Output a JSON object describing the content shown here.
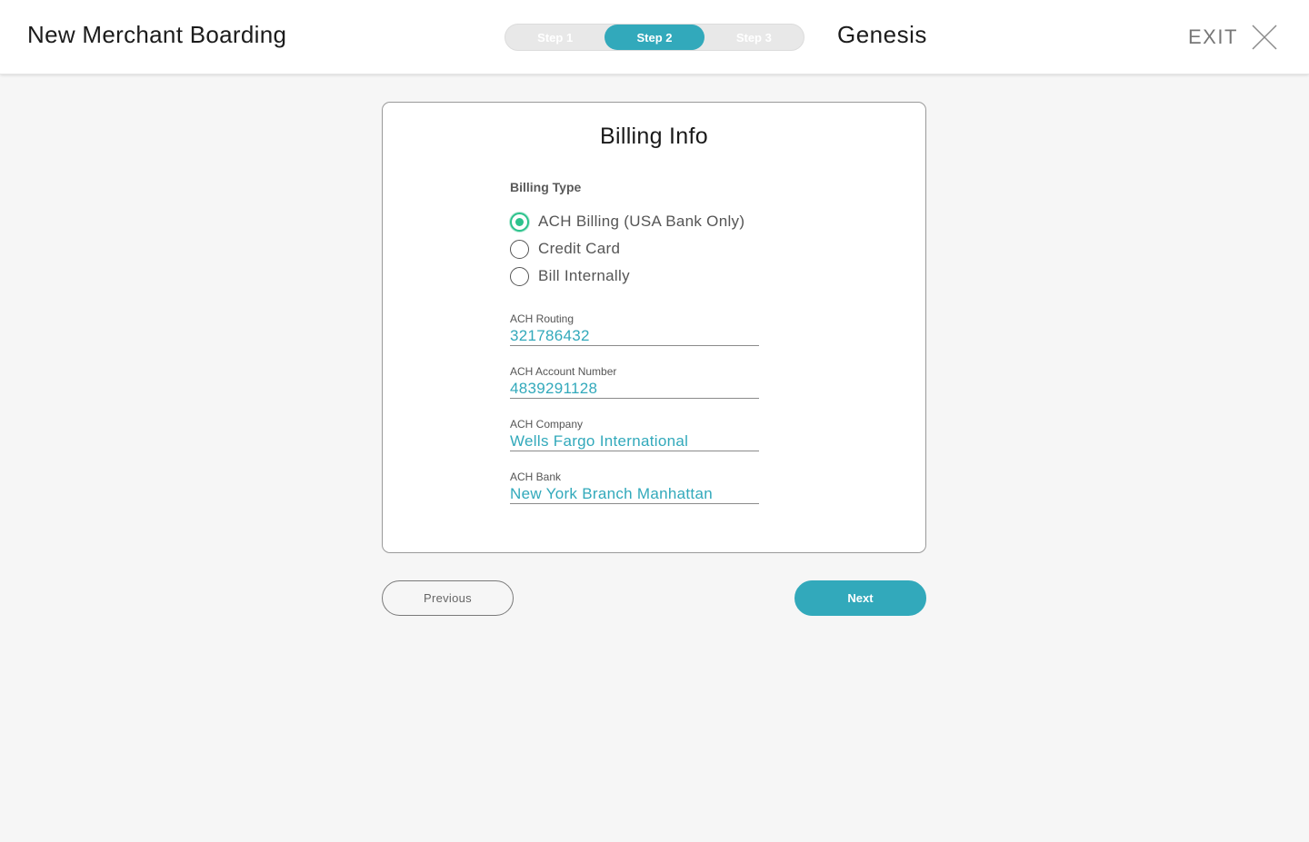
{
  "header": {
    "title": "New Merchant Boarding",
    "brand": "Genesis",
    "exit_label": "EXIT",
    "steps": [
      {
        "label": "Step 1",
        "active": false
      },
      {
        "label": "Step 2",
        "active": true
      },
      {
        "label": "Step 3",
        "active": false
      }
    ]
  },
  "card": {
    "title": "Billing Info",
    "billing_type_label": "Billing Type",
    "billing_options": [
      {
        "label": "ACH Billing (USA Bank Only)",
        "selected": true
      },
      {
        "label": "Credit Card",
        "selected": false
      },
      {
        "label": "Bill Internally",
        "selected": false
      }
    ],
    "fields": [
      {
        "label": "ACH Routing",
        "value": "321786432"
      },
      {
        "label": "ACH Account Number",
        "value": "4839291128"
      },
      {
        "label": "ACH Company",
        "value": "Wells Fargo International"
      },
      {
        "label": "ACH Bank",
        "value": "New York Branch Manhattan"
      }
    ]
  },
  "buttons": {
    "previous": "Previous",
    "next": "Next"
  },
  "colors": {
    "accent": "#32a9bb",
    "radio_selected": "#2cc28c",
    "background": "#f6f6f6"
  },
  "icons": {
    "exit": "close-icon"
  }
}
